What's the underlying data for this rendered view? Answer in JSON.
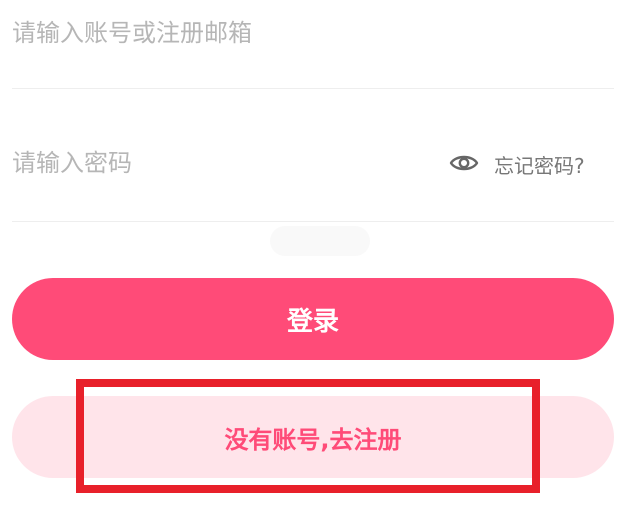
{
  "login_form": {
    "account_placeholder": "请输入账号或注册邮箱",
    "account_value": "",
    "password_placeholder": "请输入密码",
    "password_value": "",
    "forgot_password_label": "忘记密码?",
    "login_button_label": "登录",
    "register_button_label": "没有账号,去注册"
  },
  "icons": {
    "password_toggle": "eye-icon"
  },
  "colors": {
    "primary": "#ff4b78",
    "primary_light": "#ffe4ea",
    "placeholder": "#b6b6b6",
    "secondary_text": "#777777",
    "divider": "#eeeeee",
    "annotation_highlight": "#e8202a"
  }
}
